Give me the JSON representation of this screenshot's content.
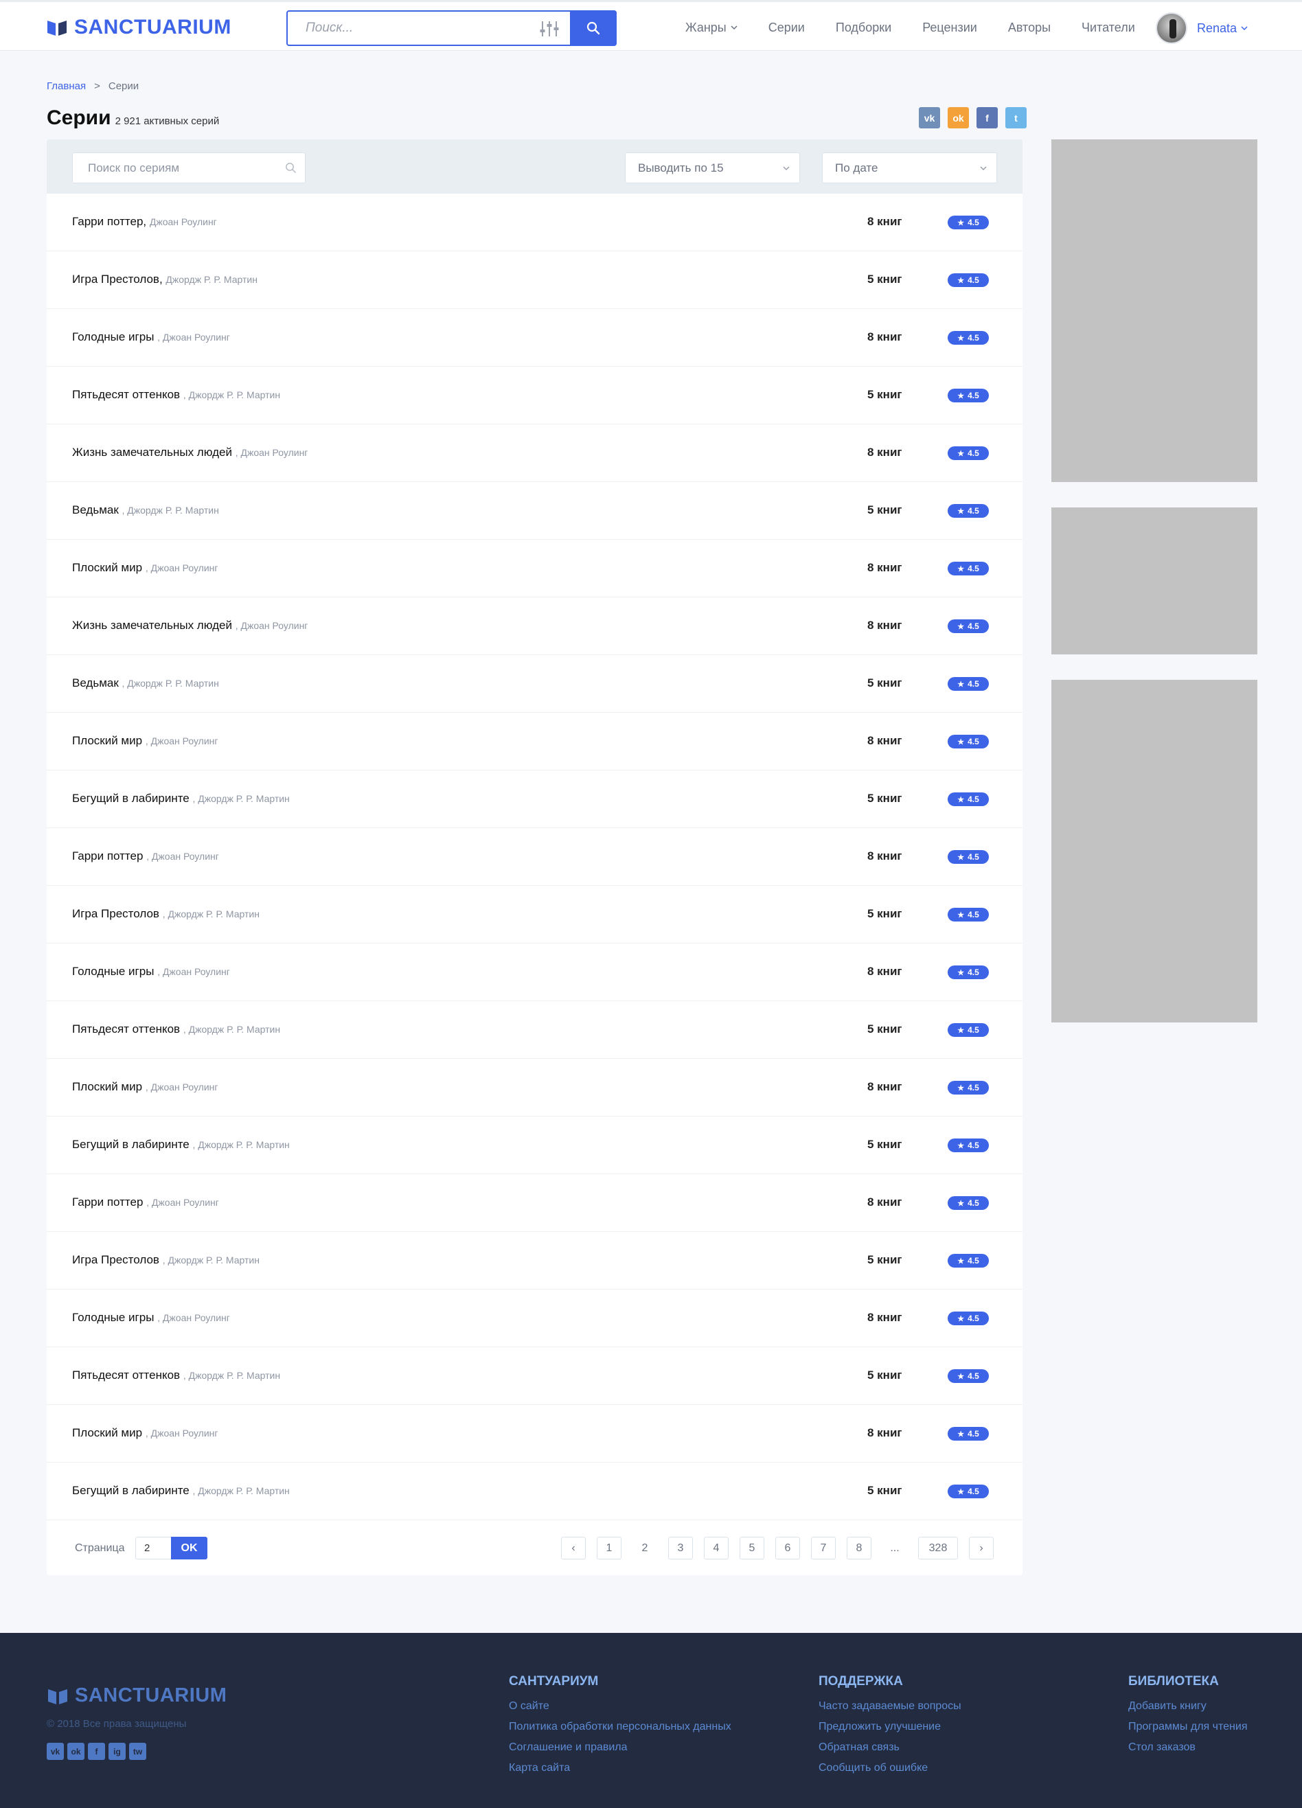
{
  "header": {
    "logo": "SANCTUARIUM",
    "search_placeholder": "Поиск...",
    "nav": [
      "Жанры",
      "Серии",
      "Подборки",
      "Рецензии",
      "Авторы",
      "Читатели"
    ],
    "user_name": "Renata"
  },
  "breadcrumb": {
    "home": "Главная",
    "separator": ">",
    "current": "Серии"
  },
  "page": {
    "title": "Серии",
    "count": "2 921 активных серий"
  },
  "share": {
    "vk": "vk",
    "ok": "ok",
    "fb": "f",
    "tw": "t"
  },
  "toolbar": {
    "search_placeholder": "Поиск по сериям",
    "per_page": "Выводить по 15",
    "sort": "По дате"
  },
  "series": [
    {
      "title": "Гарри поттер,",
      "author": "Джоан Роулинг",
      "books": "8 книг",
      "rating": "4.5"
    },
    {
      "title": "Игра Престолов,",
      "author": "Джордж Р. Р. Мартин",
      "books": "5 книг",
      "rating": "4.5"
    },
    {
      "title": "Голодные игры",
      "author": ", Джоан Роулинг",
      "books": "8 книг",
      "rating": "4.5"
    },
    {
      "title": "Пятьдесят оттенков",
      "author": ", Джордж Р. Р. Мартин",
      "books": "5 книг",
      "rating": "4.5"
    },
    {
      "title": "Жизнь замечательных людей",
      "author": ", Джоан Роулинг",
      "books": "8 книг",
      "rating": "4.5"
    },
    {
      "title": "Ведьмак",
      "author": ", Джордж Р. Р. Мартин",
      "books": "5 книг",
      "rating": "4.5"
    },
    {
      "title": "Плоский мир",
      "author": ", Джоан Роулинг",
      "books": "8 книг",
      "rating": "4.5"
    },
    {
      "title": "Жизнь замечательных людей",
      "author": ", Джоан Роулинг",
      "books": "8 книг",
      "rating": "4.5"
    },
    {
      "title": "Ведьмак",
      "author": ", Джордж Р. Р. Мартин",
      "books": "5 книг",
      "rating": "4.5"
    },
    {
      "title": "Плоский мир",
      "author": ", Джоан Роулинг",
      "books": "8 книг",
      "rating": "4.5"
    },
    {
      "title": "Бегущий в лабиринте",
      "author": ", Джордж Р. Р. Мартин",
      "books": "5 книг",
      "rating": "4.5"
    },
    {
      "title": "Гарри поттер",
      "author": ", Джоан Роулинг",
      "books": "8 книг",
      "rating": "4.5"
    },
    {
      "title": "Игра Престолов",
      "author": ", Джордж Р. Р. Мартин",
      "books": "5 книг",
      "rating": "4.5"
    },
    {
      "title": "Голодные игры",
      "author": ", Джоан Роулинг",
      "books": "8 книг",
      "rating": "4.5"
    },
    {
      "title": "Пятьдесят оттенков",
      "author": ", Джордж Р. Р. Мартин",
      "books": "5 книг",
      "rating": "4.5"
    },
    {
      "title": "Плоский мир",
      "author": ", Джоан Роулинг",
      "books": "8 книг",
      "rating": "4.5"
    },
    {
      "title": "Бегущий в лабиринте",
      "author": ", Джордж Р. Р. Мартин",
      "books": "5 книг",
      "rating": "4.5"
    },
    {
      "title": "Гарри поттер",
      "author": ", Джоан Роулинг",
      "books": "8 книг",
      "rating": "4.5"
    },
    {
      "title": "Игра Престолов",
      "author": ", Джордж Р. Р. Мартин",
      "books": "5 книг",
      "rating": "4.5"
    },
    {
      "title": "Голодные игры",
      "author": ", Джоан Роулинг",
      "books": "8 книг",
      "rating": "4.5"
    },
    {
      "title": "Пятьдесят оттенков",
      "author": ", Джордж Р. Р. Мартин",
      "books": "5 книг",
      "rating": "4.5"
    },
    {
      "title": "Плоский мир",
      "author": ", Джоан Роулинг",
      "books": "8 книг",
      "rating": "4.5"
    },
    {
      "title": "Бегущий в лабиринте",
      "author": ", Джордж Р. Р. Мартин",
      "books": "5 книг",
      "rating": "4.5"
    }
  ],
  "pagination": {
    "label": "Страница",
    "input_value": "2",
    "ok": "OK",
    "prev": "‹",
    "next": "›",
    "pages": [
      "1",
      "2",
      "3",
      "4",
      "5",
      "6",
      "7",
      "8",
      "...",
      "328"
    ],
    "current": "2"
  },
  "footer": {
    "logo": "SANCTUARIUM",
    "copyright": "© 2018 Все права защищены",
    "social": [
      "vk",
      "ok",
      "f",
      "ig",
      "tw"
    ],
    "columns": [
      {
        "title": "Сантуариум",
        "links": [
          "О сайте",
          "Политика обработки персональных данных",
          "Соглашение и правила",
          "Карта сайта"
        ]
      },
      {
        "title": "Поддержка",
        "links": [
          "Часто задаваемые вопросы",
          "Предложить улучшение",
          "Обратная связь",
          "Сообщить об ошибке"
        ]
      },
      {
        "title": "Библиотека",
        "links": [
          "Добавить книгу",
          "Программы для чтения",
          "Стол заказов"
        ]
      }
    ]
  },
  "colors": {
    "accent": "#3d63e6",
    "footer_bg": "#232b40",
    "ad_placeholder": "#c2c2c2"
  }
}
